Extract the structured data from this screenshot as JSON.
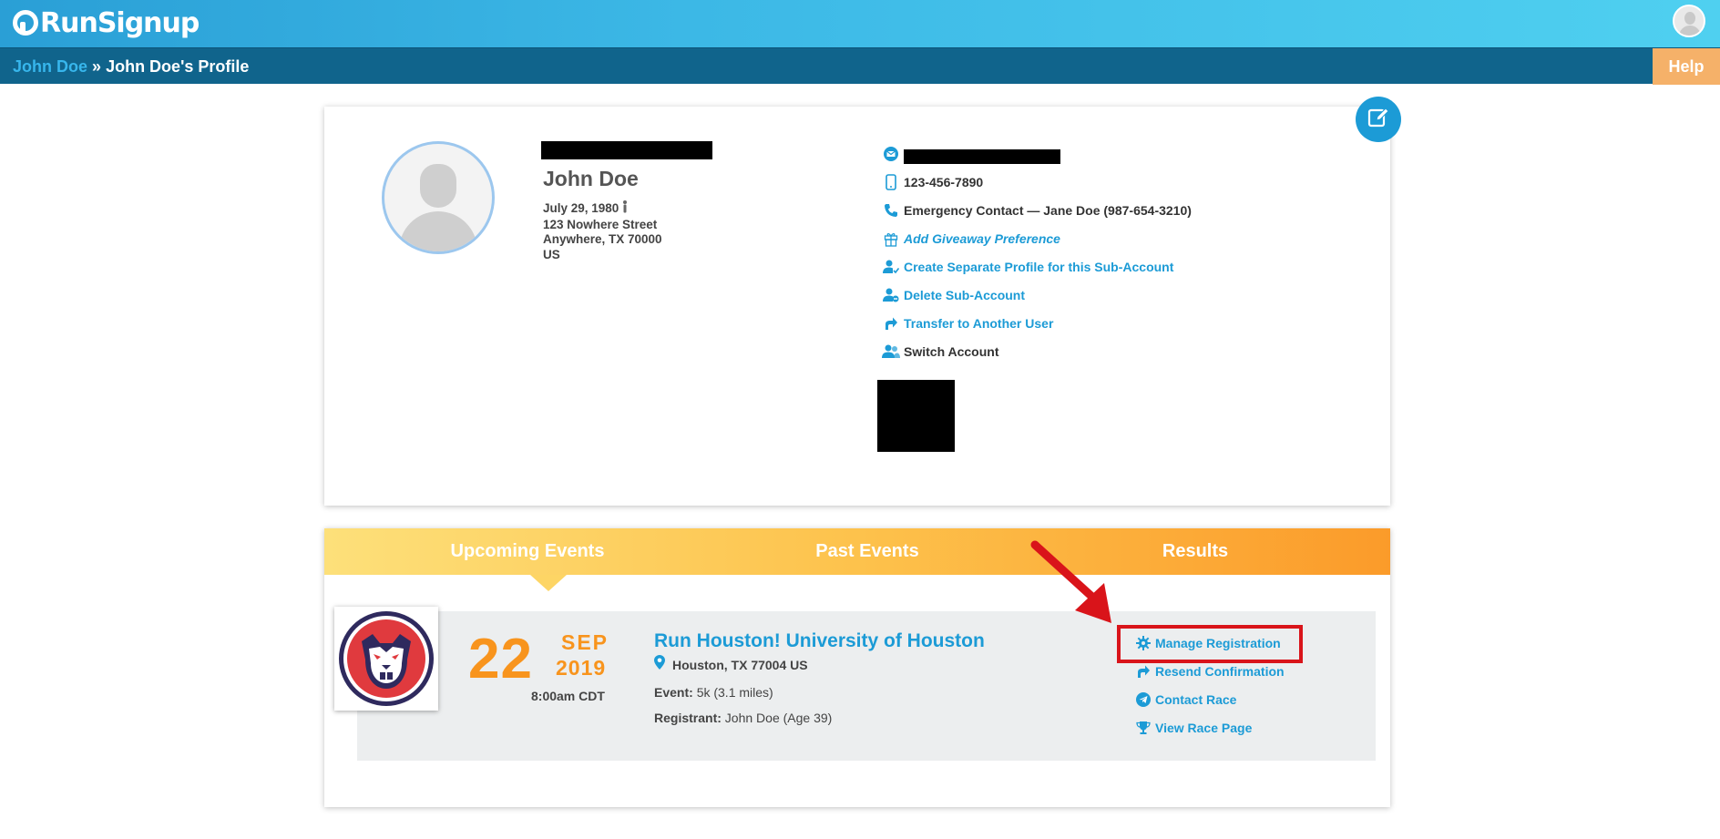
{
  "app": {
    "logo_text": "RunSignup"
  },
  "header": {
    "help_label": "Help"
  },
  "breadcrumb": {
    "parent": "John Doe",
    "separator": "»",
    "current": "John Doe's Profile"
  },
  "profile": {
    "name": "John Doe",
    "birthdate": "July 29, 1980",
    "address_line1": "123 Nowhere Street",
    "address_line2": "Anywhere, TX 70000",
    "country": "US",
    "phone": "123-456-7890",
    "emergency_contact": "Emergency Contact — Jane Doe (987-654-3210)",
    "giveaway_link": "Add Giveaway Preference",
    "create_profile_link": "Create Separate Profile for this Sub-Account",
    "delete_link": "Delete Sub-Account",
    "transfer_link": "Transfer to Another User",
    "switch_link": "Switch Account"
  },
  "tabs": [
    {
      "label": "Upcoming Events",
      "active": true
    },
    {
      "label": "Past Events",
      "active": false
    },
    {
      "label": "Results",
      "active": false
    }
  ],
  "event": {
    "day": "22",
    "month": "SEP",
    "year": "2019",
    "time": "8:00am CDT",
    "title": "Run Houston! University of Houston",
    "location": "Houston, TX 77004 US",
    "event_label": "Event:",
    "event_value": "5k (3.1 miles)",
    "registrant_label": "Registrant:",
    "registrant_value": "John Doe (Age 39)",
    "actions": {
      "manage": "Manage Registration",
      "resend": "Resend Confirmation",
      "contact": "Contact Race",
      "view": "View Race Page"
    }
  },
  "colors": {
    "accent": "#1c9bd6",
    "date_orange": "#f8941d",
    "highlight_red": "#d9141a",
    "crumb_bar": "#10648c",
    "help_orange": "#f5b169"
  },
  "icons": [
    "edit-icon",
    "email-icon",
    "phone-icon",
    "emergency-phone-icon",
    "gift-icon",
    "user-add-icon",
    "user-remove-icon",
    "transfer-icon",
    "switch-user-icon",
    "location-pin-icon",
    "gear-icon",
    "share-icon",
    "send-icon",
    "trophy-icon"
  ]
}
